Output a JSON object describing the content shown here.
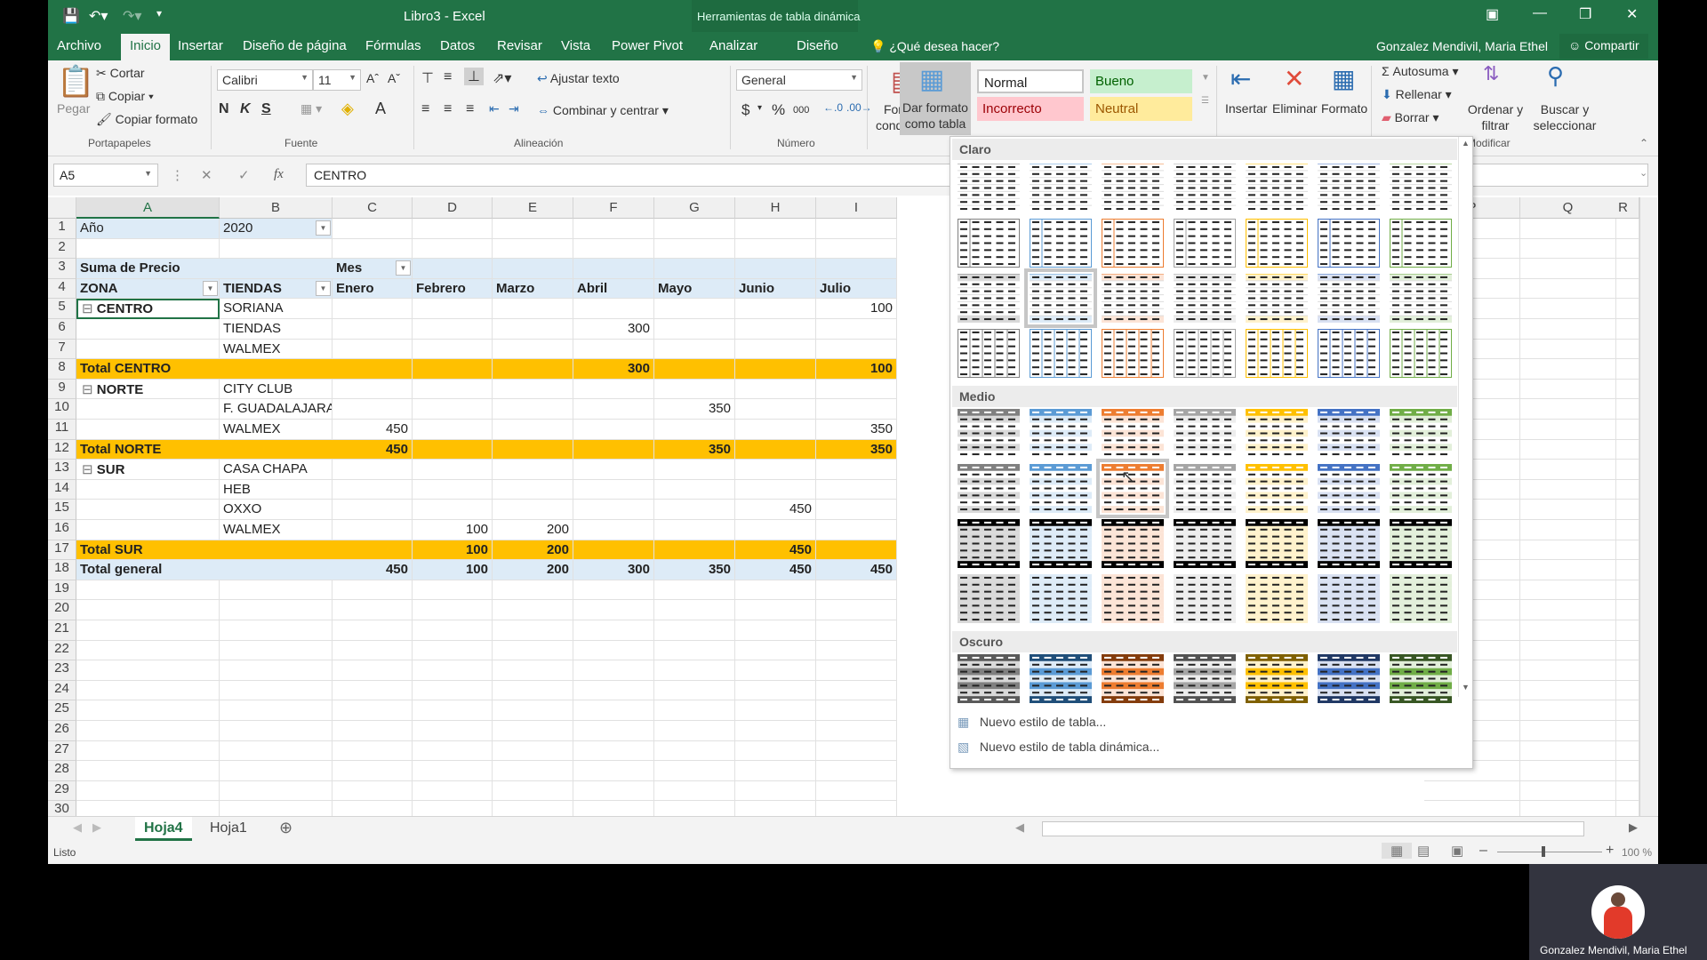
{
  "window": {
    "title": "Libro3 - Excel",
    "context_tools": "Herramientas de tabla dinámica",
    "user": "Gonzalez Mendivil, Maria Ethel",
    "share": "Compartir",
    "tell_me": "¿Qué desea hacer?"
  },
  "tabs": [
    "Archivo",
    "Inicio",
    "Insertar",
    "Diseño de página",
    "Fórmulas",
    "Datos",
    "Revisar",
    "Vista",
    "Power Pivot",
    "Analizar",
    "Diseño"
  ],
  "active_tab": "Inicio",
  "ribbon": {
    "clipboard": {
      "paste": "Pegar",
      "cut": "Cortar",
      "copy": "Copiar",
      "format_painter": "Copiar formato",
      "group": "Portapapeles"
    },
    "font": {
      "name": "Calibri",
      "size": "11",
      "bold": "N",
      "italic": "K",
      "underline": "S",
      "group": "Fuente"
    },
    "alignment": {
      "wrap": "Ajustar texto",
      "merge": "Combinar y centrar",
      "group": "Alineación"
    },
    "number": {
      "format": "General",
      "currency": "$",
      "percent": "%",
      "thousands": "000",
      "group": "Número"
    },
    "styles": {
      "conditional": "Formato condicional",
      "as_table": "Dar formato como tabla",
      "normal": "Normal",
      "good": "Bueno",
      "bad": "Incorrecto",
      "neutral": "Neutral"
    },
    "cells": {
      "insert": "Insertar",
      "delete": "Eliminar",
      "format": "Formato"
    },
    "editing": {
      "autosum": "Autosuma",
      "fill": "Rellenar",
      "clear": "Borrar",
      "sort": "Ordenar y filtrar",
      "find": "Buscar y seleccionar",
      "group": "Modificar"
    }
  },
  "formula_bar": {
    "name_box": "A5",
    "fx": "fx",
    "value": "CENTRO"
  },
  "columns": [
    "A",
    "B",
    "C",
    "D",
    "E",
    "F",
    "G",
    "H",
    "I"
  ],
  "columns_right": [
    "P",
    "Q",
    "R"
  ],
  "rows": [
    "1",
    "2",
    "3",
    "4",
    "5",
    "6",
    "7",
    "8",
    "9",
    "10",
    "11",
    "12",
    "13",
    "14",
    "15",
    "16",
    "17",
    "18",
    "19",
    "20",
    "21",
    "22",
    "23",
    "24",
    "25",
    "26",
    "27",
    "28",
    "29",
    "30"
  ],
  "pivot": {
    "filter_label": "Año",
    "filter_value": "2020",
    "values_label": "Suma de Precio",
    "col_field": "Mes",
    "row_field_1": "ZONA",
    "row_field_2": "TIENDAS",
    "months": [
      "Enero",
      "Febrero",
      "Marzo",
      "Abril",
      "Mayo",
      "Junio",
      "Julio"
    ],
    "rows": [
      {
        "zona": "CENTRO",
        "tienda": "SORIANA",
        "vals": [
          "",
          "",
          "",
          "",
          "",
          "",
          "100"
        ]
      },
      {
        "zona": "",
        "tienda": "TIENDAS",
        "vals": [
          "",
          "",
          "",
          "300",
          "",
          "",
          ""
        ]
      },
      {
        "zona": "",
        "tienda": "WALMEX",
        "vals": [
          "",
          "",
          "",
          "",
          "",
          "",
          ""
        ]
      },
      {
        "total": "Total CENTRO",
        "vals": [
          "",
          "",
          "",
          "300",
          "",
          "",
          "100"
        ]
      },
      {
        "zona": "NORTE",
        "tienda": "CITY CLUB",
        "vals": [
          "",
          "",
          "",
          "",
          "",
          "",
          ""
        ]
      },
      {
        "zona": "",
        "tienda": "F. GUADALAJARA",
        "vals": [
          "",
          "",
          "",
          "",
          "350",
          "",
          ""
        ]
      },
      {
        "zona": "",
        "tienda": "WALMEX",
        "vals": [
          "450",
          "",
          "",
          "",
          "",
          "",
          "350"
        ]
      },
      {
        "total": "Total NORTE",
        "vals": [
          "450",
          "",
          "",
          "",
          "350",
          "",
          "350"
        ]
      },
      {
        "zona": "SUR",
        "tienda": "CASA CHAPA",
        "vals": [
          "",
          "",
          "",
          "",
          "",
          "",
          ""
        ]
      },
      {
        "zona": "",
        "tienda": "HEB",
        "vals": [
          "",
          "",
          "",
          "",
          "",
          "",
          ""
        ]
      },
      {
        "zona": "",
        "tienda": "OXXO",
        "vals": [
          "",
          "",
          "",
          "",
          "",
          "450",
          ""
        ]
      },
      {
        "zona": "",
        "tienda": "WALMEX",
        "vals": [
          "",
          "100",
          "200",
          "",
          "",
          "",
          ""
        ]
      },
      {
        "total": "Total SUR",
        "vals": [
          "",
          "100",
          "200",
          "",
          "",
          "450",
          ""
        ]
      },
      {
        "grand": "Total general",
        "vals": [
          "450",
          "100",
          "200",
          "300",
          "350",
          "450",
          "450"
        ]
      }
    ]
  },
  "gallery": {
    "sections": [
      "Claro",
      "Medio",
      "Oscuro"
    ],
    "colors": [
      "#808080",
      "#5b9bd5",
      "#ed7d31",
      "#a5a5a5",
      "#ffc000",
      "#4472c4",
      "#70ad47"
    ],
    "dark_colors": [
      "#595959",
      "#1f4e79",
      "#843c0c",
      "#525252",
      "#7f6000",
      "#203864",
      "#375623"
    ],
    "light_fills": [
      "#d9d9d9",
      "#ddebf7",
      "#fce4d6",
      "#ededed",
      "#fff2cc",
      "#d9e1f2",
      "#e2efda"
    ],
    "new_table_style": "Nuevo estilo de tabla...",
    "new_pivot_style": "Nuevo estilo de tabla dinámica..."
  },
  "sheets": [
    "Hoja4",
    "Hoja1"
  ],
  "active_sheet": "Hoja4",
  "status": {
    "ready": "Listo",
    "zoom": "100 %"
  },
  "camera": {
    "name": "Gonzalez Mendivil, Maria Ethel"
  }
}
